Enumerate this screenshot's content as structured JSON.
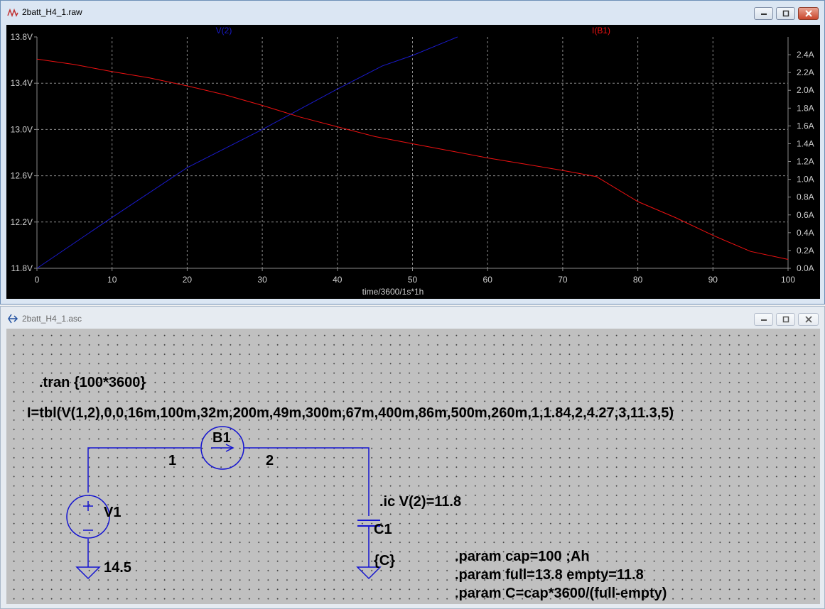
{
  "plot_window": {
    "title": "2batt_H4_1.raw",
    "trace_labels": {
      "left": "V(2)",
      "right": "I(B1)"
    },
    "colors": {
      "background": "#000000",
      "grid": "#8a8a8a",
      "axis_text": "#cfcfcf",
      "v_trace": "#1a1acc",
      "i_trace": "#ee1111"
    }
  },
  "chart_data": {
    "type": "line",
    "xlabel": "time/3600/1s*1h",
    "xlim": [
      0,
      100
    ],
    "x_ticks": [
      "0",
      "10",
      "20",
      "30",
      "40",
      "50",
      "60",
      "70",
      "80",
      "90",
      "100"
    ],
    "y_left": {
      "range": [
        11.8,
        13.8
      ],
      "ticks": [
        "11.8V",
        "12.2V",
        "12.6V",
        "13.0V",
        "13.4V",
        "13.8V"
      ]
    },
    "y_right": {
      "range": [
        0,
        2.6
      ],
      "ticks": [
        "0.0A",
        "0.2A",
        "0.4A",
        "0.6A",
        "0.8A",
        "1.0A",
        "1.2A",
        "1.4A",
        "1.6A",
        "1.8A",
        "2.0A",
        "2.2A",
        "2.4A"
      ]
    },
    "series": [
      {
        "name": "V(2)",
        "axis": "left",
        "color": "#1a1acc",
        "x": [
          0,
          10,
          20,
          30,
          40,
          46,
          50,
          56
        ],
        "y": [
          11.8,
          12.24,
          12.67,
          13.0,
          13.35,
          13.55,
          13.64,
          13.8
        ]
      },
      {
        "name": "I(B1)",
        "axis": "right",
        "color": "#ee1111",
        "x": [
          0,
          5,
          10,
          15,
          20,
          25,
          30,
          35,
          40,
          45,
          50,
          55,
          60,
          65,
          70,
          74.5,
          80,
          85,
          90,
          95,
          100
        ],
        "y": [
          2.35,
          2.29,
          2.21,
          2.14,
          2.05,
          1.95,
          1.83,
          1.7,
          1.59,
          1.48,
          1.4,
          1.32,
          1.24,
          1.17,
          1.1,
          1.03,
          0.75,
          0.57,
          0.37,
          0.19,
          0.1
        ]
      }
    ]
  },
  "schematic_window": {
    "title": "2batt_H4_1.asc",
    "directives": {
      "tran": ".tran {100*3600}",
      "behavioral": "I=tbl(V(1,2),0,0,16m,100m,32m,200m,49m,300m,67m,400m,86m,500m,260m,1,1.84,2,4.27,3,11.3,5)",
      "ic": ".ic V(2)=11.8",
      "param1": ".param cap=100 ;Ah",
      "param2": ".param full=13.8 empty=11.8",
      "param3": ".param C=cap*3600/(full-empty)"
    },
    "components": {
      "b1": {
        "name": "B1",
        "node_in": "1",
        "node_out": "2"
      },
      "v1": {
        "name": "V1",
        "value": "14.5"
      },
      "c1": {
        "name": "C1",
        "value": "{C}"
      }
    },
    "colors": {
      "background": "#c0c0c0",
      "wire": "#1414d0",
      "text": "#000000"
    }
  },
  "window_buttons": {
    "minimize": "minimize-icon",
    "maximize": "maximize-icon",
    "close": "close-icon"
  }
}
